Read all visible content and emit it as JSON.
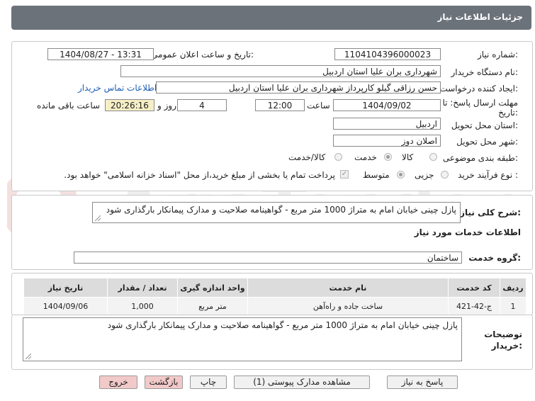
{
  "header": {
    "title": "جزئیات اطلاعات نیاز"
  },
  "watermark": {
    "text": "AriaTender.net"
  },
  "info": {
    "need_number_label": "شماره نیاز:",
    "need_number": "1104104396000023",
    "announce_label": "تاریخ و ساعت اعلان عمومی:",
    "announce_value": "1404/08/27 - 13:31",
    "buyer_org_label": "نام دستگاه خریدار:",
    "buyer_org": "شهرداری بران علیا استان اردبیل",
    "creator_label": "ایجاد کننده درخواست:",
    "creator": "حسن رزاقی گیلو کارپرداز شهرداری بران علیا استان اردبیل",
    "contact_link": "اطلاعات تماس خریدار",
    "deadline_label_1": "مهلت ارسال پاسخ: تا",
    "deadline_label_2": "تاریخ:",
    "deadline_date": "1404/09/02",
    "time_label": "ساعت",
    "deadline_time": "12:00",
    "days_value": "4",
    "days_label": "روز و",
    "remaining_time": "20:26:16",
    "remaining_label": "ساعت باقی مانده",
    "province_label": "استان محل تحویل:",
    "province": "اردبیل",
    "city_label": "شهر محل تحویل:",
    "city": "اصلان دوز",
    "category_label": "طبقه بندی موضوعی:",
    "category_options": [
      "کالا",
      "خدمت",
      "کالا/خدمت"
    ],
    "category_selected": "خدمت",
    "process_label": "نوع فرآیند خرید :",
    "process_options": [
      "جزیی",
      "متوسط"
    ],
    "process_selected": "متوسط",
    "payment_note": "پرداخت تمام یا بخشی از مبلغ خرید،از محل \"اسناد خزانه اسلامی\" خواهد بود."
  },
  "description": {
    "label": "شرح کلی نیاز:",
    "text": "پازل چینی خیابان امام به متراژ 1000 متر مربع  - گواهینامه صلاحیت و مدارک پیمانکار بارگذاری شود"
  },
  "services": {
    "section_title": "اطلاعات خدمات مورد نیاز",
    "group_label": "گروه خدمت:",
    "group_value": "ساختمان",
    "table": {
      "headers": [
        "ردیف",
        "کد خدمت",
        "نام خدمت",
        "واحد اندازه گیری",
        "تعداد / مقدار",
        "تاریخ نیاز"
      ],
      "rows": [
        [
          "1",
          "ج-42-421",
          "ساخت جاده و راه‌آهن",
          "متر مربع",
          "1,000",
          "1404/09/06"
        ]
      ]
    }
  },
  "buyer_notes": {
    "label_1": "توضیحات",
    "label_2": "خریدار:",
    "text": "پازل چینی خیابان امام به متراژ 1000 متر مربع  - گواهینامه صلاحیت و مدارک پیمانکار بارگذاری شود"
  },
  "buttons": {
    "reply": "پاسخ به نیاز",
    "attachments": "مشاهده مدارک پیوستی (1)",
    "print": "چاپ",
    "back": "بازگشت",
    "exit": "خروج"
  }
}
